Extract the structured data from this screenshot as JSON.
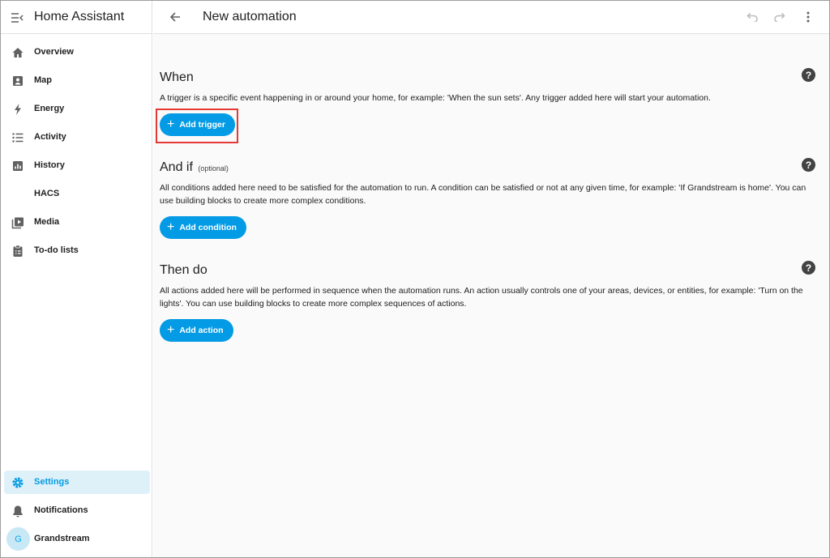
{
  "sidebar": {
    "app_title": "Home Assistant",
    "items": [
      {
        "label": "Overview",
        "icon": "home-icon"
      },
      {
        "label": "Map",
        "icon": "map-icon"
      },
      {
        "label": "Energy",
        "icon": "lightning-bolt-icon"
      },
      {
        "label": "Activity",
        "icon": "format-list-icon"
      },
      {
        "label": "History",
        "icon": "chart-box-icon"
      },
      {
        "label": "HACS",
        "icon": ""
      },
      {
        "label": "Media",
        "icon": "play-box-multiple-icon"
      },
      {
        "label": "To-do lists",
        "icon": "clipboard-list-icon"
      }
    ],
    "settings_label": "Settings",
    "notifications_label": "Notifications",
    "user_label": "Grandstream",
    "user_initial": "G"
  },
  "header": {
    "title": "New automation"
  },
  "sections": {
    "when": {
      "title": "When",
      "description": "A trigger is a specific event happening in or around your home, for example: 'When the sun sets'. Any trigger added here will start your automation.",
      "button": "Add trigger"
    },
    "and_if": {
      "title": "And if",
      "optional": "(optional)",
      "description": "All conditions added here need to be satisfied for the automation to run. A condition can be satisfied or not at any given time, for example: 'If Grandstream is home'. You can use building blocks to create more complex conditions.",
      "button": "Add condition"
    },
    "then_do": {
      "title": "Then do",
      "description": "All actions added here will be performed in sequence when the automation runs. An action usually controls one of your areas, devices, or entities, for example: 'Turn on the lights'. You can use building blocks to create more complex sequences of actions.",
      "button": "Add action"
    }
  },
  "colors": {
    "accent": "#039be5",
    "active_bg": "#dff1f8",
    "highlight_box": "#e53935"
  }
}
